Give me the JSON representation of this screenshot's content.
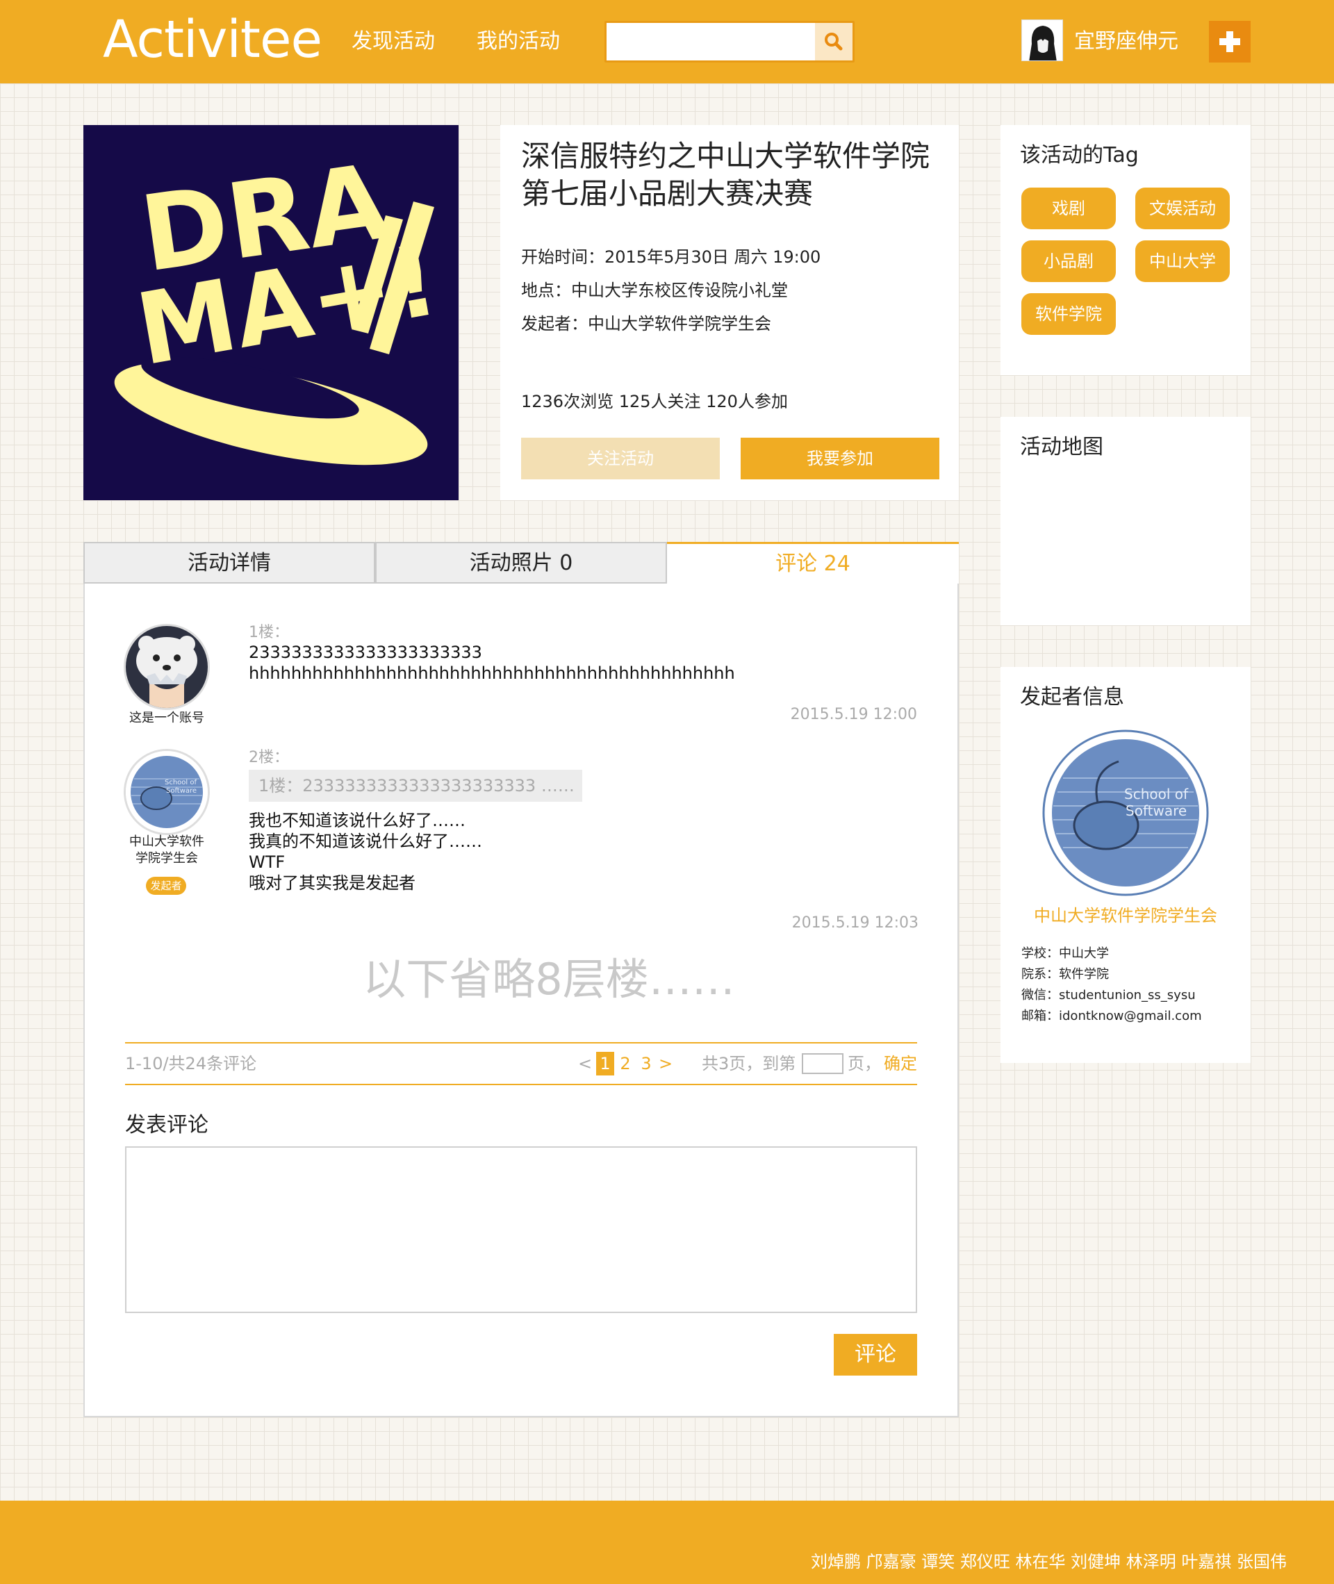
{
  "header": {
    "logo": "Activitee",
    "nav": [
      "发现活动",
      "我的活动"
    ],
    "search_placeholder": "",
    "username": "宜野座伸元"
  },
  "poster": {
    "line1": "DRA",
    "line2": "MA+!"
  },
  "event": {
    "title_line1": "深信服特约之中山大学软件学院",
    "title_line2": "第七届小品剧大赛决赛",
    "start_time": "开始时间：2015年5月30日 周六 19:00",
    "location": "地点：中山大学东校区传设院小礼堂",
    "organizer": "发起者：中山大学软件学院学生会",
    "stats": "1236次浏览   125人关注   120人参加",
    "follow_label": "关注活动",
    "join_label": "我要参加"
  },
  "tags_panel": {
    "title": "该活动的Tag",
    "tags": [
      "戏剧",
      "文娱活动",
      "小品剧",
      "中山大学",
      "软件学院"
    ]
  },
  "map_panel": {
    "title": "活动地图"
  },
  "organizer_panel": {
    "title": "发起者信息",
    "logo_text": "School of Software",
    "name": "中山大学软件学院学生会",
    "school": "学校：中山大学",
    "department": "院系：软件学院",
    "wechat": "微信：studentunion_ss_sysu",
    "email": "邮箱：idontknow@gmail.com"
  },
  "tabs": [
    {
      "label": "活动详情"
    },
    {
      "label": "活动照片 0"
    },
    {
      "label": "评论 24"
    }
  ],
  "comments": [
    {
      "floor": "1楼：",
      "lines": [
        "2333333333333333333333",
        "hhhhhhhhhhhhhhhhhhhhhhhhhhhhhhhhhhhhhhhhhhhhhh"
      ],
      "author": "这是一个账号",
      "time": "2015.5.19 12:00"
    },
    {
      "floor": "2楼：",
      "quote": "1楼：2333333333333333333333  ……",
      "lines": [
        "我也不知道该说什么好了……",
        "我真的不知道该说什么好了……",
        "WTF",
        "哦对了其实我是发起者"
      ],
      "author_line1": "中山大学软件",
      "author_line2": "学院学生会",
      "badge": "发起者",
      "time": "2015.5.19 12:03"
    }
  ],
  "omitted_text": "以下省略8层楼……",
  "pagination": {
    "summary": "1-10/共24条评论",
    "prev": "<",
    "pages": [
      "1",
      "2",
      "3"
    ],
    "next": ">",
    "total_text": "共3页，到第",
    "page_suffix": "页，",
    "confirm": "确定"
  },
  "post_comment": {
    "title": "发表评论",
    "submit": "评论"
  },
  "footer": {
    "names": "刘焯鹏 邝嘉豪 谭笑 郑仪旺 林在华 刘健坤 林泽明 叶嘉祺 张国伟"
  },
  "colors": {
    "accent": "#f0ac23",
    "accent_dark": "#e98b10",
    "poster_bg": "#150a48",
    "poster_text": "#fff59a",
    "follow_btn": "#f3dfb3",
    "org_logo": "#5a7fb5"
  }
}
